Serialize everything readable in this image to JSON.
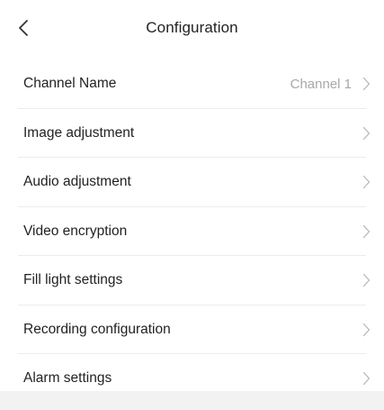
{
  "header": {
    "back_icon": "chevron-left-icon",
    "title": "Configuration"
  },
  "settings": {
    "items": [
      {
        "label": "Channel Name",
        "value": "Channel 1"
      },
      {
        "label": "Image adjustment"
      },
      {
        "label": "Audio adjustment"
      },
      {
        "label": "Video encryption"
      },
      {
        "label": "Fill light settings"
      },
      {
        "label": "Recording configuration"
      },
      {
        "label": "Alarm settings"
      }
    ]
  },
  "colors": {
    "background": "#ffffff",
    "text": "#222222",
    "secondary_text": "#a8a8a8",
    "chevron": "#b5b5b5",
    "divider": "#ececec",
    "bottom_area": "#f2f2f2"
  }
}
